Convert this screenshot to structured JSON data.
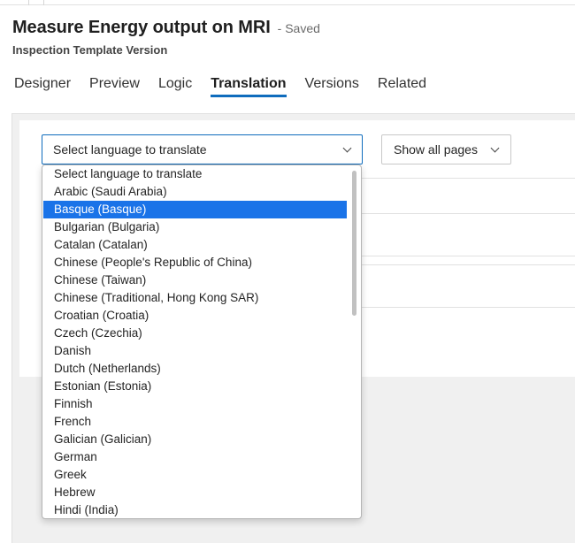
{
  "header": {
    "title": "Measure Energy output on MRI",
    "saved_state": "- Saved",
    "subtitle": "Inspection Template Version"
  },
  "tabs": [
    {
      "label": "Designer",
      "active": false
    },
    {
      "label": "Preview",
      "active": false
    },
    {
      "label": "Logic",
      "active": false
    },
    {
      "label": "Translation",
      "active": true
    },
    {
      "label": "Versions",
      "active": false
    },
    {
      "label": "Related",
      "active": false
    }
  ],
  "translation": {
    "language_select": {
      "value": "Select language to translate",
      "expanded": true,
      "highlighted_option": "Basque (Basque)",
      "options": [
        "Select language to translate",
        "Arabic (Saudi Arabia)",
        "Basque (Basque)",
        "Bulgarian (Bulgaria)",
        "Catalan (Catalan)",
        "Chinese (People's Republic of China)",
        "Chinese (Taiwan)",
        "Chinese (Traditional, Hong Kong SAR)",
        "Croatian (Croatia)",
        "Czech (Czechia)",
        "Danish",
        "Dutch (Netherlands)",
        "Estonian (Estonia)",
        "Finnish",
        "French",
        "Galician (Galician)",
        "German",
        "Greek",
        "Hebrew",
        "Hindi (India)"
      ]
    },
    "pages_select": {
      "value": "Show all pages"
    }
  },
  "colors": {
    "accent": "#0f6cbd",
    "selected_option_bg": "#1a73e8",
    "content_bg": "#f0f0f0"
  }
}
